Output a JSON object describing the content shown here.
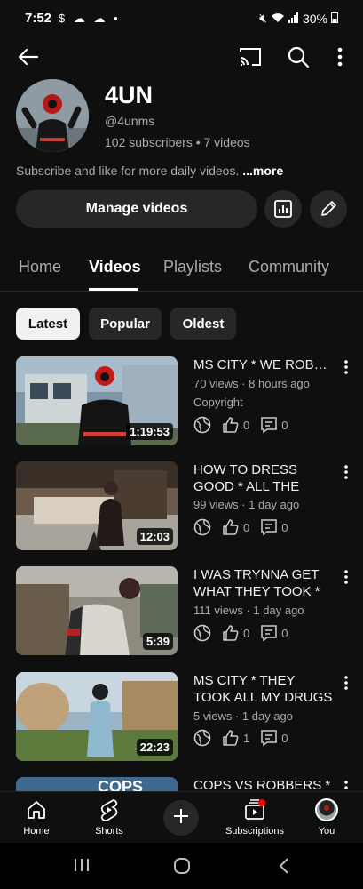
{
  "status_bar": {
    "time": "7:52",
    "left_icons": "$ ☁ ☁ •",
    "battery": "30%"
  },
  "top_bar": {
    "icons": [
      "back-arrow-icon",
      "cast-icon",
      "search-icon",
      "more-vert-icon"
    ]
  },
  "channel": {
    "name": "4UN",
    "handle": "@4unms",
    "stats": "102 subscribers • 7 videos",
    "description": "Subscribe and like for more daily videos. ",
    "more_label": "...more",
    "manage_label": "Manage videos"
  },
  "tabs": [
    "Home",
    "Videos",
    "Playlists",
    "Community"
  ],
  "active_tab": "Videos",
  "chips": [
    "Latest",
    "Popular",
    "Oldest"
  ],
  "active_chip": "Latest",
  "videos": [
    {
      "title": "MS CITY * WE ROBBED THE SAFE *",
      "views": "70 views · 8 hours ago",
      "extra": "Copyright",
      "duration": "1:19:53",
      "likes": "0",
      "comments": "0"
    },
    {
      "title": "HOW TO DRESS GOOD * ALL THE NEW CLOTHES *",
      "views": "99 views · 1 day ago",
      "extra": "",
      "duration": "12:03",
      "likes": "0",
      "comments": "0"
    },
    {
      "title": "I WAS TRYNNA GET WHAT THEY TOOK * MS CITY *",
      "views": "111 views · 1 day ago",
      "extra": "",
      "duration": "5:39",
      "likes": "0",
      "comments": "0"
    },
    {
      "title": "MS CITY * THEY TOOK ALL MY DRUGS *",
      "views": "5 views · 1 day ago",
      "extra": "",
      "duration": "22:23",
      "likes": "1",
      "comments": "0"
    },
    {
      "title": "COPS VS ROBBERS *",
      "views": "",
      "extra": "",
      "duration": "",
      "likes": "",
      "comments": "",
      "thumb_text": "COPS"
    }
  ],
  "bottom_nav": [
    "Home",
    "Shorts",
    "Subscriptions",
    "You"
  ],
  "colors": {
    "background": "#0f0f0f",
    "chip": "#272727",
    "text_secondary": "#aaaaaa",
    "notification": "#ff0000"
  }
}
